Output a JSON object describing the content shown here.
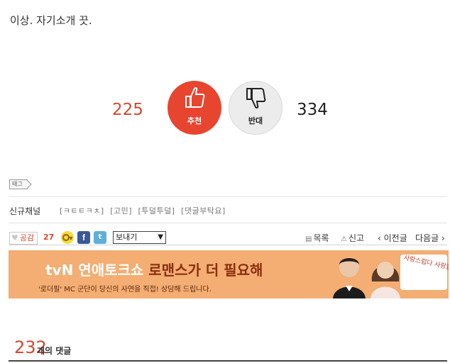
{
  "post": {
    "closing_text": "이상. 자기소개 끗."
  },
  "vote": {
    "up_count": "225",
    "up_label": "추천",
    "down_count": "334",
    "down_label": "반대",
    "up_color": "#e84530",
    "down_color": "#ececec"
  },
  "tag": {
    "label": "태그"
  },
  "channels": {
    "label": "신규채널",
    "items": [
      "[ㅋㅌㅌㅋㅊ]",
      "[고민]",
      "[투덜투덜]",
      "[댓글부탁요]"
    ]
  },
  "actions": {
    "empathy_label": "공감",
    "empathy_count": "27",
    "facebook_glyph": "f",
    "twitter_glyph": "t",
    "view_select": "보내기",
    "list_label": "목록",
    "report_label": "신고",
    "prev_label": "‹ 이전글",
    "next_label": "다음글 ›"
  },
  "banner": {
    "title_prefix": "tvN 연애토크쇼 ",
    "title_highlight": "로맨스가 더 필요해",
    "subtitle": "'로더필' MC 군단이 당신의 사연을 직접! 상담해 드립니다.",
    "sticker_text": "사랑스럽다 사랑합니다",
    "bg_color": "#f4ad72"
  },
  "comments": {
    "count": "232",
    "label": "개의 댓글"
  }
}
